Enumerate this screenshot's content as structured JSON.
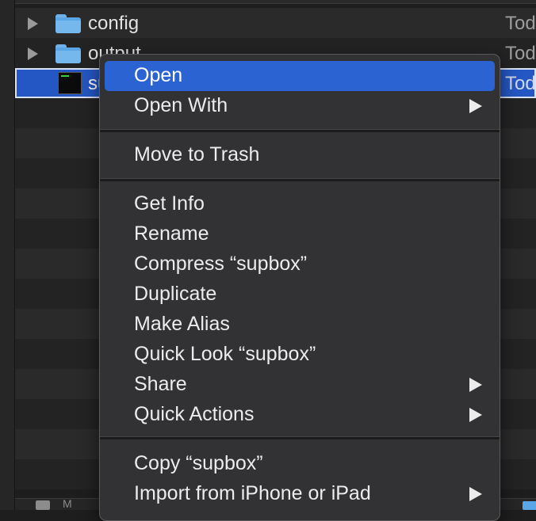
{
  "finder": {
    "rows": [
      {
        "name": "config",
        "date": "Tod",
        "kind": "folder"
      },
      {
        "name": "output",
        "date": "Tod",
        "kind": "folder"
      },
      {
        "name": "su",
        "date": "Tod",
        "kind": "executable",
        "selected": true
      }
    ],
    "bottom_label": "M"
  },
  "context_menu": {
    "items": [
      {
        "label": "Open",
        "highlighted": true,
        "submenu": false
      },
      {
        "label": "Open With",
        "submenu": true
      },
      {
        "label": "Move to Trash",
        "submenu": false
      },
      {
        "label": "Get Info",
        "submenu": false
      },
      {
        "label": "Rename",
        "submenu": false
      },
      {
        "label": "Compress “supbox”",
        "submenu": false
      },
      {
        "label": "Duplicate",
        "submenu": false
      },
      {
        "label": "Make Alias",
        "submenu": false
      },
      {
        "label": "Quick Look “supbox”",
        "submenu": false
      },
      {
        "label": "Share",
        "submenu": true
      },
      {
        "label": "Quick Actions",
        "submenu": true
      },
      {
        "label": "Copy “supbox”",
        "submenu": false
      },
      {
        "label": "Import from iPhone or iPad",
        "submenu": true
      }
    ]
  },
  "colors": {
    "highlight": "#2b64d2",
    "folder": "#5aa6e6",
    "menu_bg": "#323234"
  }
}
